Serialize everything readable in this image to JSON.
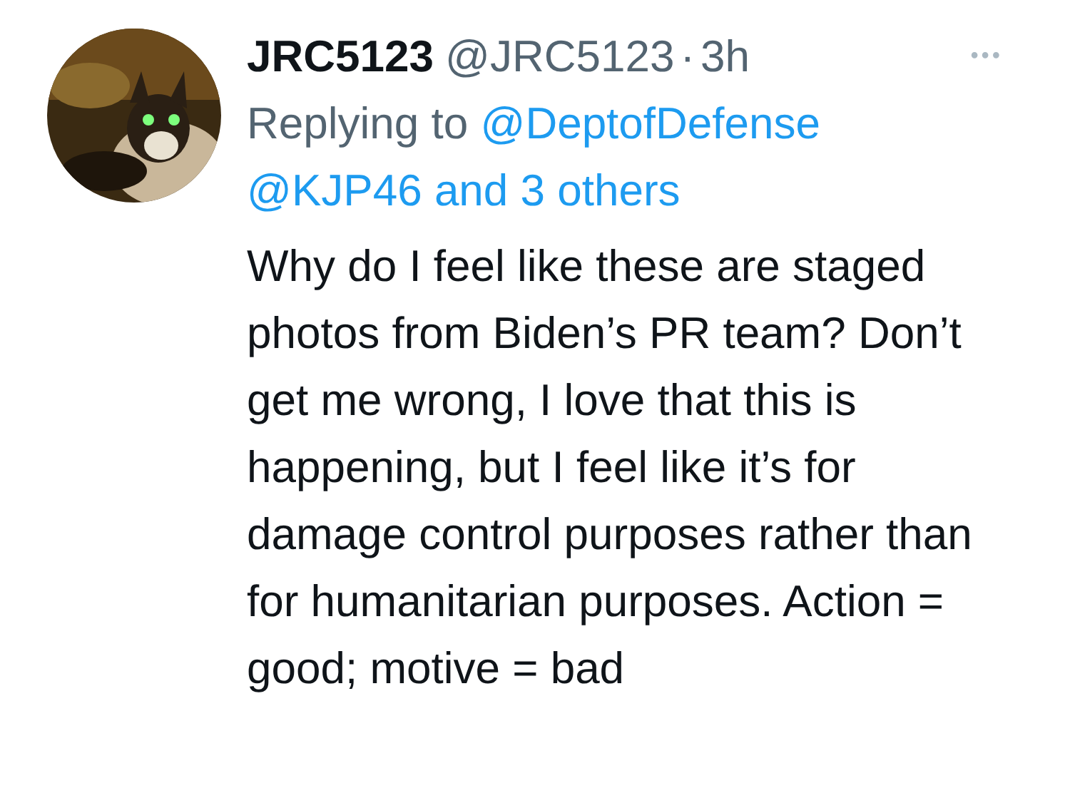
{
  "tweet": {
    "author_name": "JRC5123",
    "handle": "@JRC5123",
    "separator": "·",
    "time": "3h",
    "more": "•••",
    "reply": {
      "prefix": "Replying to",
      "mentions": [
        "@DeptofDefense",
        "@KJP46",
        "and 3 others"
      ]
    },
    "text": "Why do I feel like these are staged photos from Biden’s PR team? Don’t get me wrong, I love that this is happening, but I feel like it’s for damage control purposes rather than for humanitarian purposes. Action = good; motive = bad"
  }
}
